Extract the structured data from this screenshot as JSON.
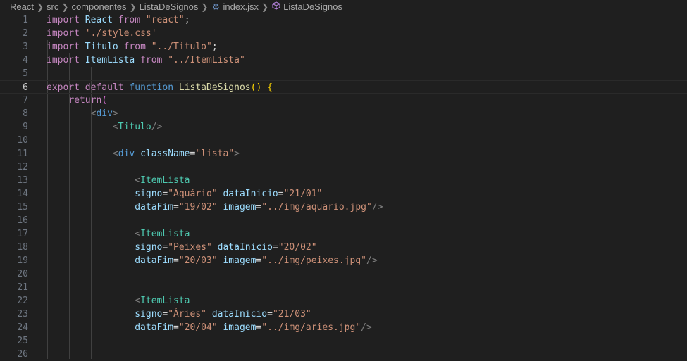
{
  "breadcrumb": {
    "items": [
      "React",
      "src",
      "componentes",
      "ListaDeSignos",
      "index.jsx",
      "ListaDeSignos"
    ],
    "icons": [
      "gear-icon",
      "cube-icon"
    ]
  },
  "editor": {
    "current_line": 6,
    "lines": [
      {
        "n": "1",
        "tokens": [
          [
            "kw",
            "import"
          ],
          [
            "pun",
            " "
          ],
          [
            "var",
            "React"
          ],
          [
            "pun",
            " "
          ],
          [
            "kw",
            "from"
          ],
          [
            "pun",
            " "
          ],
          [
            "str",
            "\"react\""
          ],
          [
            "pun",
            ";"
          ]
        ]
      },
      {
        "n": "2",
        "tokens": [
          [
            "kw",
            "import"
          ],
          [
            "pun",
            " "
          ],
          [
            "str",
            "'./style.css'"
          ]
        ]
      },
      {
        "n": "3",
        "tokens": [
          [
            "kw",
            "import"
          ],
          [
            "pun",
            " "
          ],
          [
            "var",
            "Titulo"
          ],
          [
            "pun",
            " "
          ],
          [
            "kw",
            "from"
          ],
          [
            "pun",
            " "
          ],
          [
            "str",
            "\"../Titulo\""
          ],
          [
            "pun",
            ";"
          ]
        ]
      },
      {
        "n": "4",
        "tokens": [
          [
            "kw",
            "import"
          ],
          [
            "pun",
            " "
          ],
          [
            "var",
            "ItemLista"
          ],
          [
            "pun",
            " "
          ],
          [
            "kw",
            "from"
          ],
          [
            "pun",
            " "
          ],
          [
            "str",
            "\"../ItemLista\""
          ]
        ]
      },
      {
        "n": "5",
        "tokens": []
      },
      {
        "n": "6",
        "tokens": [
          [
            "kw",
            "export"
          ],
          [
            "pun",
            " "
          ],
          [
            "kw",
            "default"
          ],
          [
            "pun",
            " "
          ],
          [
            "kwb",
            "function"
          ],
          [
            "pun",
            " "
          ],
          [
            "fn",
            "ListaDeSignos"
          ],
          [
            "gold",
            "()"
          ],
          [
            "pun",
            " "
          ],
          [
            "gold",
            "{"
          ]
        ]
      },
      {
        "n": "7",
        "tokens": [
          [
            "pun",
            "    "
          ],
          [
            "kw",
            "return"
          ],
          [
            "pink",
            "("
          ]
        ]
      },
      {
        "n": "8",
        "tokens": [
          [
            "pun",
            "        "
          ],
          [
            "br",
            "<"
          ],
          [
            "kwb",
            "div"
          ],
          [
            "br",
            ">"
          ]
        ]
      },
      {
        "n": "9",
        "tokens": [
          [
            "pun",
            "            "
          ],
          [
            "br",
            "<"
          ],
          [
            "tag",
            "Titulo"
          ],
          [
            "br",
            "/>"
          ]
        ]
      },
      {
        "n": "10",
        "tokens": []
      },
      {
        "n": "11",
        "tokens": [
          [
            "pun",
            "            "
          ],
          [
            "br",
            "<"
          ],
          [
            "kwb",
            "div"
          ],
          [
            "pun",
            " "
          ],
          [
            "var",
            "className"
          ],
          [
            "pun",
            "="
          ],
          [
            "str",
            "\"lista\""
          ],
          [
            "br",
            ">"
          ]
        ]
      },
      {
        "n": "12",
        "tokens": []
      },
      {
        "n": "13",
        "tokens": [
          [
            "pun",
            "                "
          ],
          [
            "br",
            "<"
          ],
          [
            "tag",
            "ItemLista"
          ]
        ]
      },
      {
        "n": "14",
        "tokens": [
          [
            "pun",
            "                "
          ],
          [
            "var",
            "signo"
          ],
          [
            "pun",
            "="
          ],
          [
            "str",
            "\"Aquário\""
          ],
          [
            "pun",
            " "
          ],
          [
            "var",
            "dataInicio"
          ],
          [
            "pun",
            "="
          ],
          [
            "str",
            "\"21/01\""
          ]
        ]
      },
      {
        "n": "15",
        "tokens": [
          [
            "pun",
            "                "
          ],
          [
            "var",
            "dataFim"
          ],
          [
            "pun",
            "="
          ],
          [
            "str",
            "\"19/02\""
          ],
          [
            "pun",
            " "
          ],
          [
            "var",
            "imagem"
          ],
          [
            "pun",
            "="
          ],
          [
            "str",
            "\"../img/aquario.jpg\""
          ],
          [
            "br",
            "/>"
          ]
        ]
      },
      {
        "n": "16",
        "tokens": []
      },
      {
        "n": "17",
        "tokens": [
          [
            "pun",
            "                "
          ],
          [
            "br",
            "<"
          ],
          [
            "tag",
            "ItemLista"
          ]
        ]
      },
      {
        "n": "18",
        "tokens": [
          [
            "pun",
            "                "
          ],
          [
            "var",
            "signo"
          ],
          [
            "pun",
            "="
          ],
          [
            "str",
            "\"Peixes\""
          ],
          [
            "pun",
            " "
          ],
          [
            "var",
            "dataInicio"
          ],
          [
            "pun",
            "="
          ],
          [
            "str",
            "\"20/02\""
          ]
        ]
      },
      {
        "n": "19",
        "tokens": [
          [
            "pun",
            "                "
          ],
          [
            "var",
            "dataFim"
          ],
          [
            "pun",
            "="
          ],
          [
            "str",
            "\"20/03\""
          ],
          [
            "pun",
            " "
          ],
          [
            "var",
            "imagem"
          ],
          [
            "pun",
            "="
          ],
          [
            "str",
            "\"../img/peixes.jpg\""
          ],
          [
            "br",
            "/>"
          ]
        ]
      },
      {
        "n": "20",
        "tokens": []
      },
      {
        "n": "21",
        "tokens": []
      },
      {
        "n": "22",
        "tokens": [
          [
            "pun",
            "                "
          ],
          [
            "br",
            "<"
          ],
          [
            "tag",
            "ItemLista"
          ]
        ]
      },
      {
        "n": "23",
        "tokens": [
          [
            "pun",
            "                "
          ],
          [
            "var",
            "signo"
          ],
          [
            "pun",
            "="
          ],
          [
            "str",
            "\"Áries\""
          ],
          [
            "pun",
            " "
          ],
          [
            "var",
            "dataInicio"
          ],
          [
            "pun",
            "="
          ],
          [
            "str",
            "\"21/03\""
          ]
        ]
      },
      {
        "n": "24",
        "tokens": [
          [
            "pun",
            "                "
          ],
          [
            "var",
            "dataFim"
          ],
          [
            "pun",
            "="
          ],
          [
            "str",
            "\"20/04\""
          ],
          [
            "pun",
            " "
          ],
          [
            "var",
            "imagem"
          ],
          [
            "pun",
            "="
          ],
          [
            "str",
            "\"../img/aries.jpg\""
          ],
          [
            "br",
            "/>"
          ]
        ]
      },
      {
        "n": "25",
        "tokens": []
      },
      {
        "n": "26",
        "tokens": []
      }
    ]
  }
}
